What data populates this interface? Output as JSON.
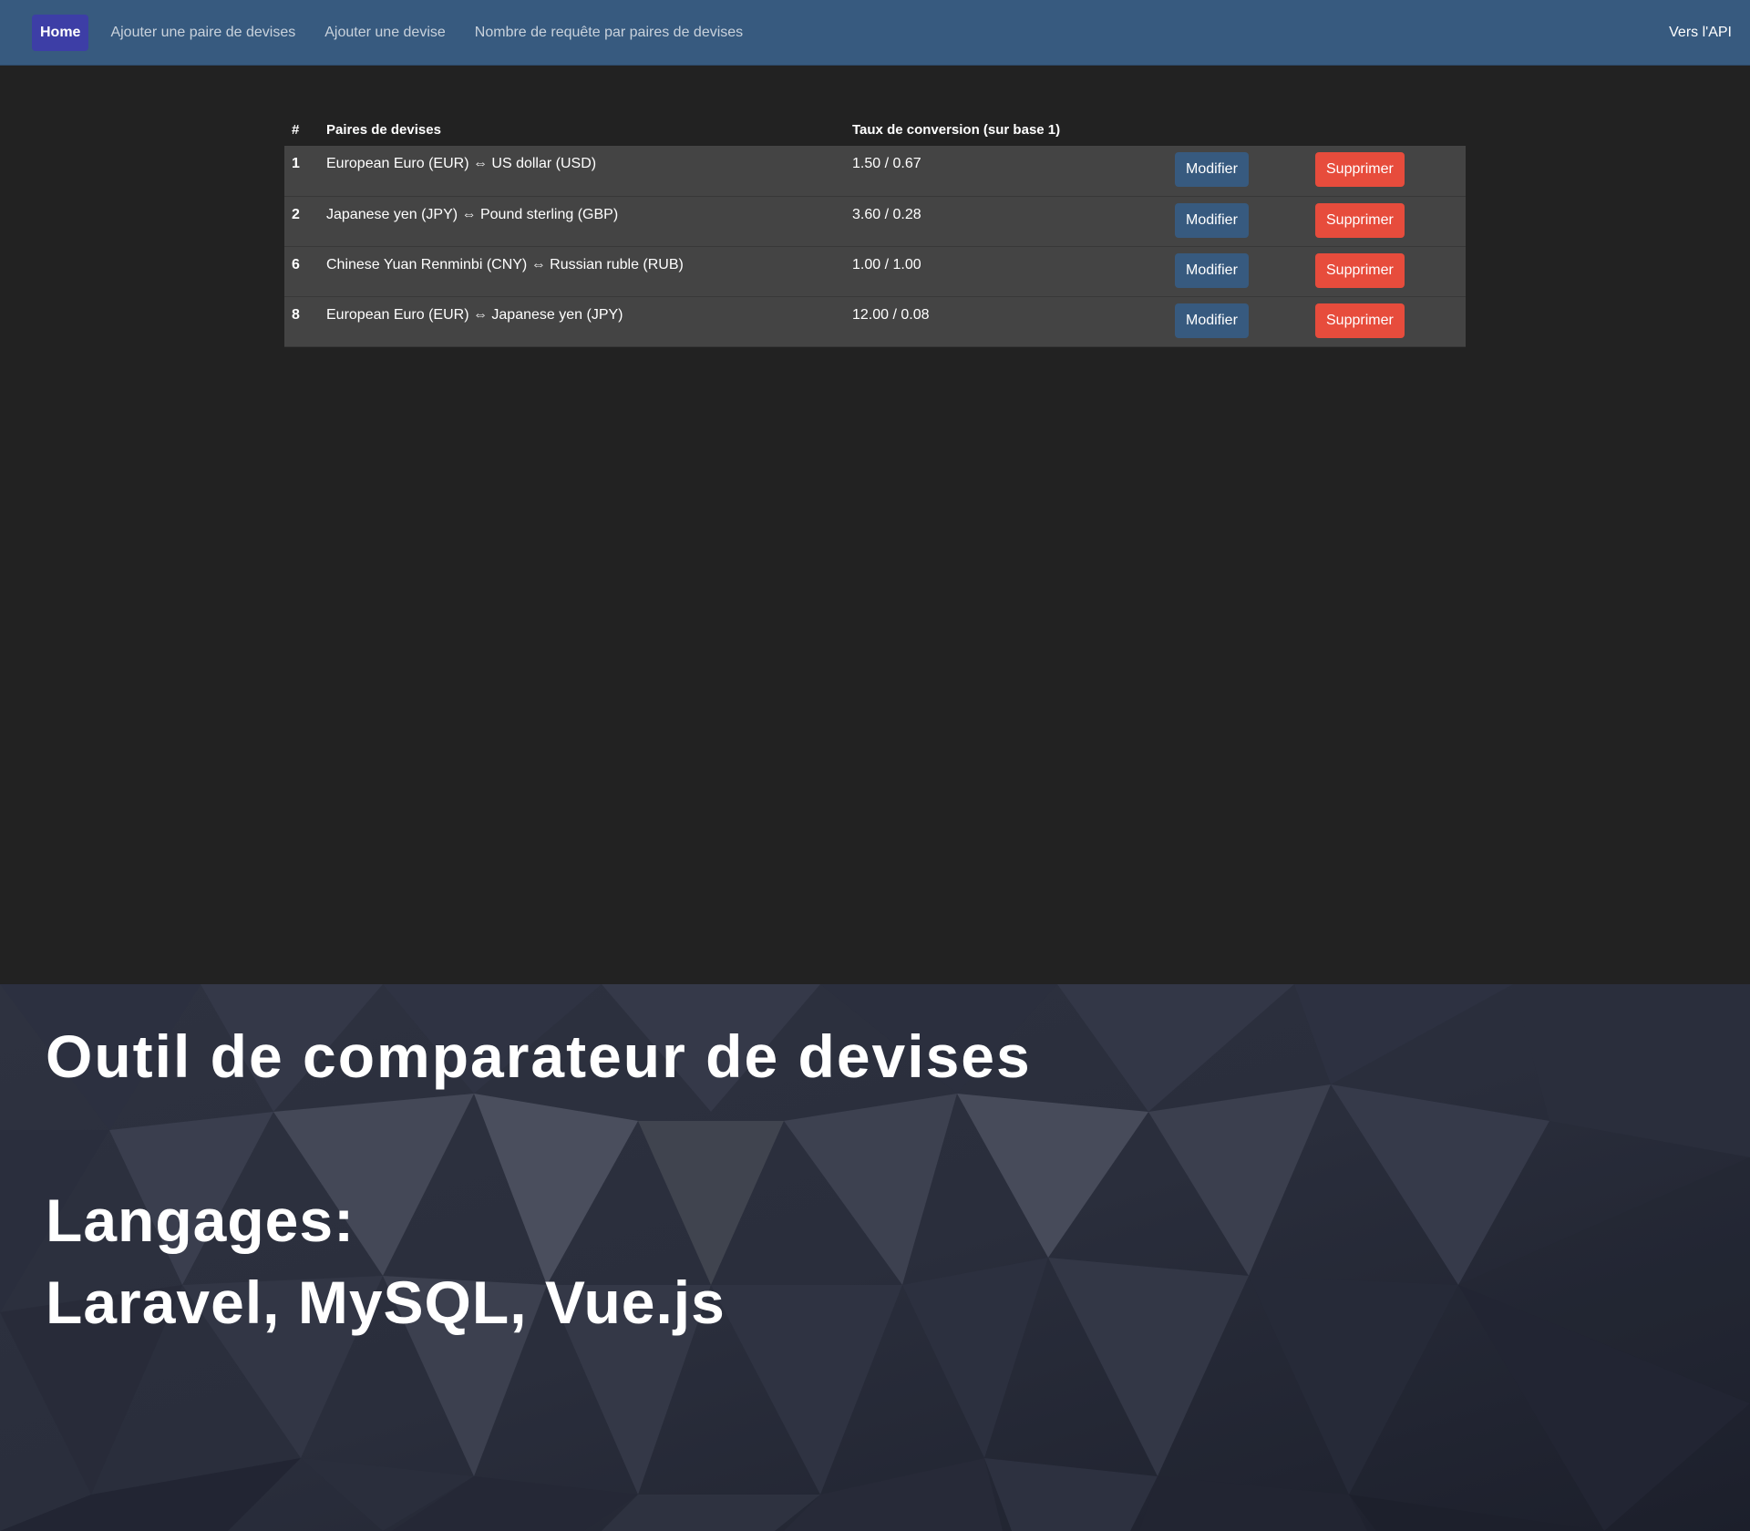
{
  "nav": {
    "home": "Home",
    "add_pair": "Ajouter une paire de devises",
    "add_currency": "Ajouter une devise",
    "requests": "Nombre de requête par paires de devises",
    "api": "Vers l'API"
  },
  "table": {
    "headers": {
      "num": "#",
      "pair": "Paires de devises",
      "rate": "Taux de conversion (sur base 1)"
    },
    "rows": [
      {
        "id": "1",
        "pair": "European Euro (EUR) ⇔ US dollar (USD)",
        "rate": "1.50 / 0.67"
      },
      {
        "id": "2",
        "pair": "Japanese yen (JPY) ⇔ Pound sterling (GBP)",
        "rate": "3.60 / 0.28"
      },
      {
        "id": "6",
        "pair": "Chinese Yuan Renminbi (CNY) ⇔ Russian ruble (RUB)",
        "rate": "1.00 / 1.00"
      },
      {
        "id": "8",
        "pair": "European Euro (EUR) ⇔ Japanese yen (JPY)",
        "rate": "12.00 / 0.08"
      }
    ],
    "edit_label": "Modifier",
    "delete_label": "Supprimer"
  },
  "banner": {
    "title": "Outil de comparateur de devises",
    "languages_label": "Langages:",
    "languages": "Laravel, MySQL, Vue.js"
  },
  "colors": {
    "navbar": "#375a7f",
    "home_active": "#3d3ea6",
    "edit_button": "#375a7f",
    "delete_button": "#e74c3c",
    "page_background": "#222222",
    "row_background": "#444444"
  }
}
